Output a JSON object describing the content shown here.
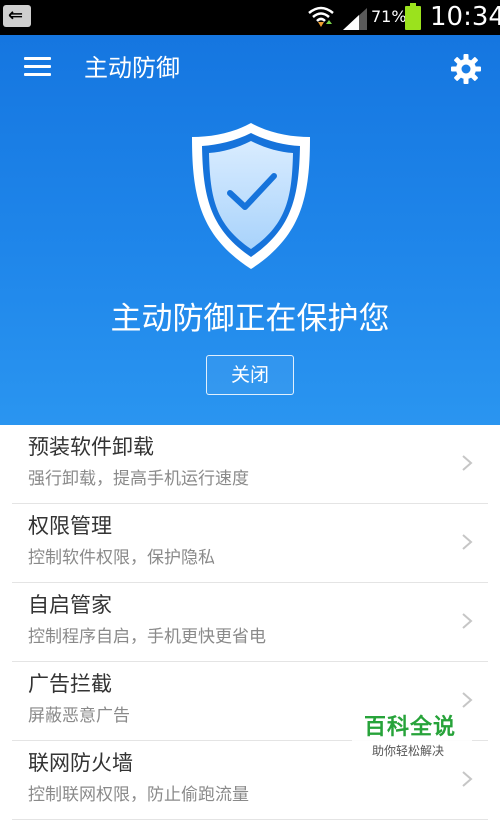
{
  "status_bar": {
    "back_glyph": "⇐",
    "battery_percent": "71%",
    "time": "10:34",
    "battery_color": "#9be21d"
  },
  "header": {
    "title": "主动防御",
    "menu_icon": "hamburger-menu-icon",
    "settings_icon": "gear-icon"
  },
  "hero": {
    "status_text": "主动防御正在保护您",
    "close_label": "关闭",
    "shield_icon": "shield-check-icon",
    "gradient_top": "#1576e0",
    "gradient_bottom": "#2a95f0"
  },
  "items": [
    {
      "title": "预装软件卸载",
      "subtitle": "强行卸载，提高手机运行速度"
    },
    {
      "title": "权限管理",
      "subtitle": "控制软件权限，保护隐私"
    },
    {
      "title": "自启管家",
      "subtitle": "控制程序自启，手机更快更省电"
    },
    {
      "title": "广告拦截",
      "subtitle": "屏蔽恶意广告"
    },
    {
      "title": "联网防火墙",
      "subtitle": "控制联网权限，防止偷跑流量"
    }
  ],
  "watermark": {
    "brand": "百科全说",
    "tagline": "助你轻松解决"
  }
}
